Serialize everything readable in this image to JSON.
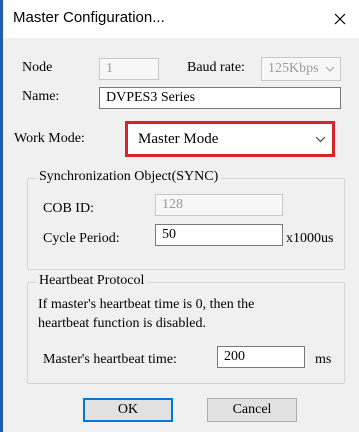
{
  "window": {
    "title": "Master Configuration...",
    "close_icon": "close-icon"
  },
  "node": {
    "label": "Node",
    "value": "1"
  },
  "baud": {
    "label": "Baud rate:",
    "value": "125Kbps"
  },
  "name": {
    "label": "Name:",
    "value": "DVPES3 Series"
  },
  "work_mode": {
    "label": "Work Mode:",
    "value": "Master Mode",
    "highlight_color": "#d8232a"
  },
  "sync": {
    "title": "Synchronization Object(SYNC)",
    "cob_label": "COB ID:",
    "cob_value": "128",
    "cycle_label": "Cycle Period:",
    "cycle_value": "50",
    "cycle_unit": "x1000us"
  },
  "heartbeat": {
    "title": "Heartbeat Protocol",
    "desc_line1": "If master's heartbeat time is 0, then the",
    "desc_line2": "heartbeat function is disabled.",
    "time_label": "Master's heartbeat time:",
    "time_value": "200",
    "time_unit": "ms"
  },
  "buttons": {
    "ok": "OK",
    "cancel": "Cancel"
  }
}
